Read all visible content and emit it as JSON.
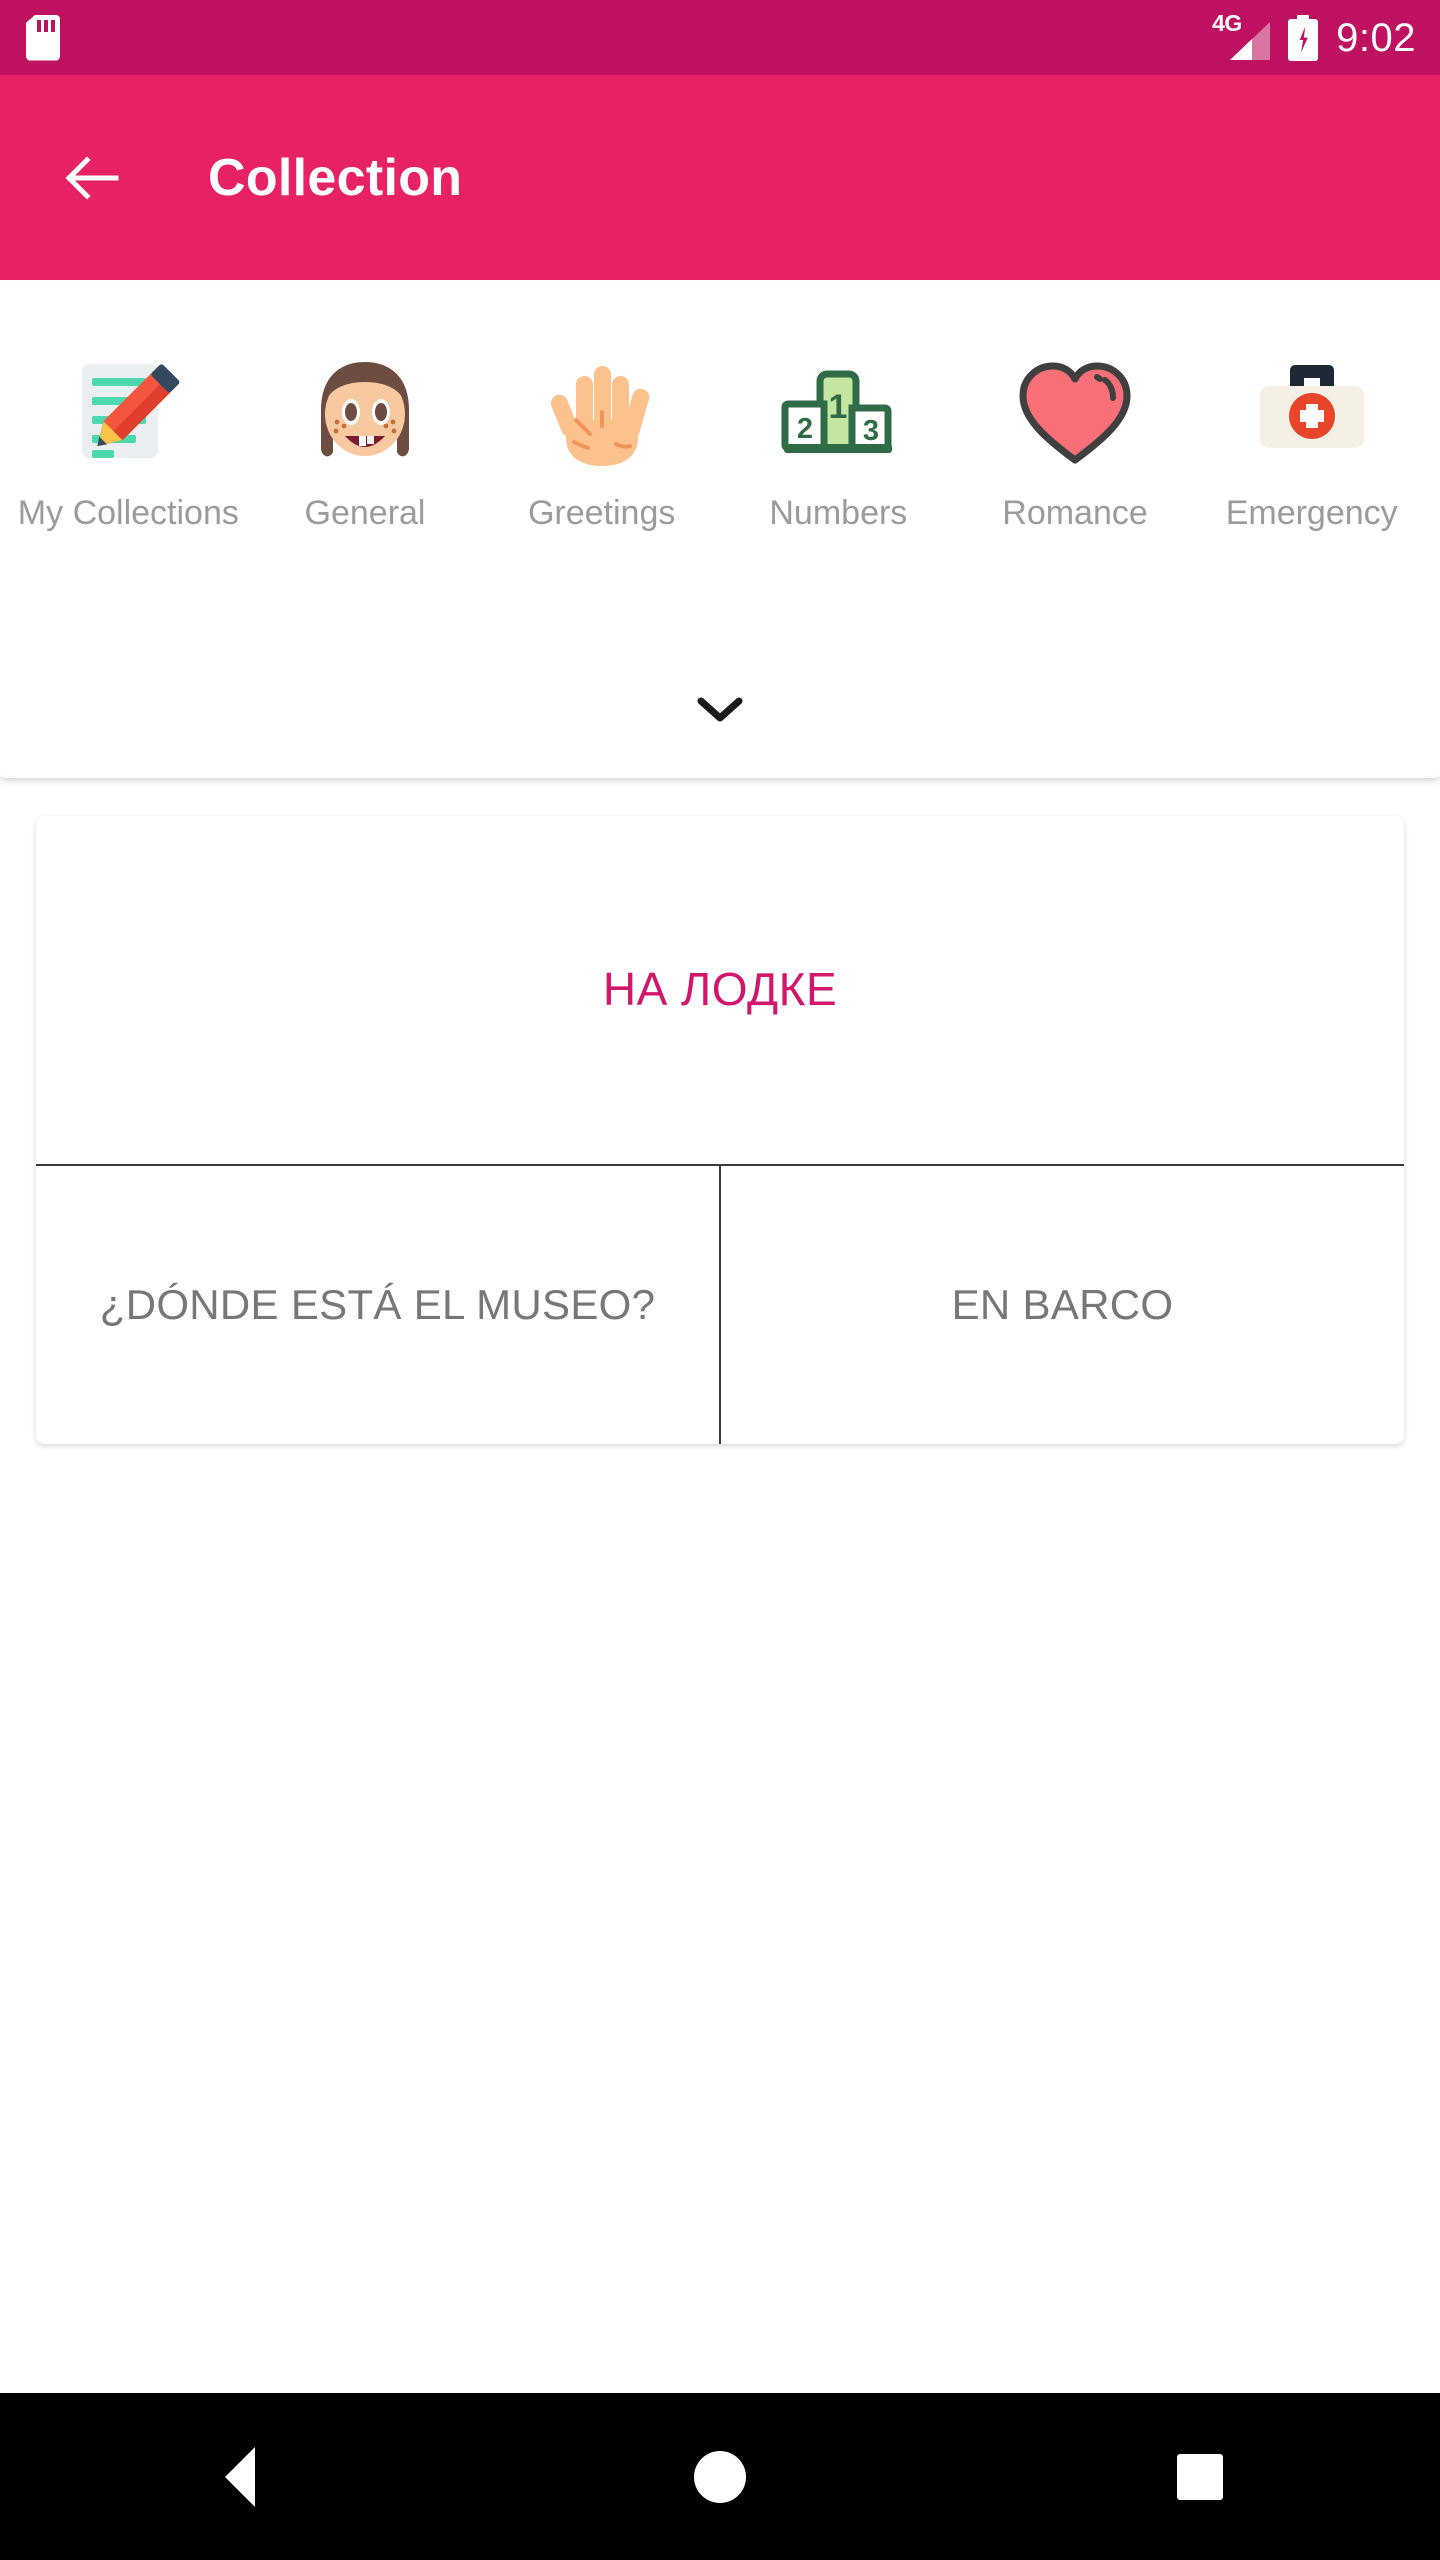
{
  "status_bar": {
    "sd_card_icon": "sd-card-icon",
    "network_label": "4G",
    "signal_icon": "signal-bars-icon",
    "battery_icon": "battery-charging-icon",
    "time": "9:02",
    "background_color": "#BE1260"
  },
  "app_bar": {
    "back_icon": "back-arrow-icon",
    "title": "Collection",
    "background_color": "#E72263"
  },
  "categories": {
    "expand_icon": "chevron-down-icon",
    "items": [
      {
        "label": "My Collections",
        "icon": "memo-pencil-icon"
      },
      {
        "label": "General",
        "icon": "girl-face-icon"
      },
      {
        "label": "Greetings",
        "icon": "raised-hand-icon"
      },
      {
        "label": "Numbers",
        "icon": "podium-icon"
      },
      {
        "label": "Romance",
        "icon": "heart-icon"
      },
      {
        "label": "Emergency",
        "icon": "first-aid-kit-icon"
      }
    ]
  },
  "phrase_card": {
    "headline": "НА ЛОДКЕ",
    "headline_color": "#D2166B",
    "left_cell": "¿DÓNDE ESTÁ EL MUSEO?",
    "right_cell": "EN BARCO",
    "cell_color": "#777777"
  },
  "nav_bar": {
    "back_icon": "nav-back-triangle-icon",
    "home_icon": "nav-home-circle-icon",
    "recents_icon": "nav-recents-square-icon"
  }
}
